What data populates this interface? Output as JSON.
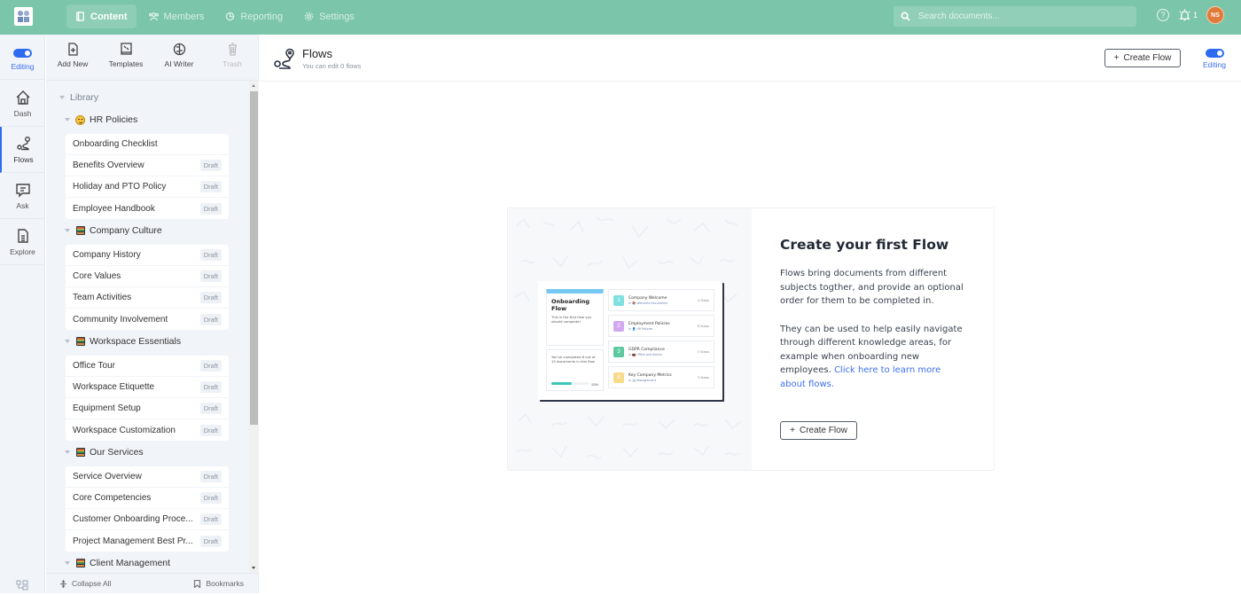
{
  "topbar": {
    "nav": [
      {
        "label": "Content",
        "icon": "book-icon",
        "active": true
      },
      {
        "label": "Members",
        "icon": "users-icon",
        "active": false
      },
      {
        "label": "Reporting",
        "icon": "chart-pie-icon",
        "active": false
      },
      {
        "label": "Settings",
        "icon": "gear-icon",
        "active": false
      }
    ],
    "search_placeholder": "Search documents...",
    "notifications_count": "1",
    "avatar_initials": "NS",
    "brand_color": "#7bc5aa"
  },
  "rail": {
    "toggle_label": "Editing",
    "items": [
      {
        "label": "Dash",
        "icon": "home-icon"
      },
      {
        "label": "Flows",
        "icon": "route-icon",
        "active": true
      },
      {
        "label": "Ask",
        "icon": "chat-icon"
      },
      {
        "label": "Explore",
        "icon": "document-icon"
      }
    ]
  },
  "sidebar": {
    "tools": [
      {
        "label": "Add New",
        "icon": "file-plus-icon"
      },
      {
        "label": "Templates",
        "icon": "template-icon"
      },
      {
        "label": "AI Writer",
        "icon": "brain-icon"
      },
      {
        "label": "Trash",
        "icon": "trash-icon",
        "disabled": true
      }
    ],
    "library_label": "Library",
    "groups": [
      {
        "name": "HR Policies",
        "icon": "smiley-icon",
        "docs": [
          {
            "title": "Onboarding Checklist",
            "badge": ""
          },
          {
            "title": "Benefits Overview",
            "badge": "Draft"
          },
          {
            "title": "Holiday and PTO Policy",
            "badge": "Draft"
          },
          {
            "title": "Employee Handbook",
            "badge": "Draft"
          }
        ]
      },
      {
        "name": "Company Culture",
        "icon": "books-icon",
        "docs": [
          {
            "title": "Company History",
            "badge": "Draft"
          },
          {
            "title": "Core Values",
            "badge": "Draft"
          },
          {
            "title": "Team Activities",
            "badge": "Draft"
          },
          {
            "title": "Community Involvement",
            "badge": "Draft"
          }
        ]
      },
      {
        "name": "Workspace Essentials",
        "icon": "books-icon",
        "docs": [
          {
            "title": "Office Tour",
            "badge": "Draft"
          },
          {
            "title": "Workspace Etiquette",
            "badge": "Draft"
          },
          {
            "title": "Equipment Setup",
            "badge": "Draft"
          },
          {
            "title": "Workspace Customization",
            "badge": "Draft"
          }
        ]
      },
      {
        "name": "Our Services",
        "icon": "books-icon",
        "docs": [
          {
            "title": "Service Overview",
            "badge": "Draft"
          },
          {
            "title": "Core Competencies",
            "badge": "Draft"
          },
          {
            "title": "Customer Onboarding Proce...",
            "badge": "Draft"
          },
          {
            "title": "Project Management Best Pr...",
            "badge": "Draft"
          }
        ]
      },
      {
        "name": "Client Management",
        "icon": "books-icon",
        "docs": []
      }
    ],
    "footer": {
      "collapse_label": "Collapse All",
      "bookmarks_label": "Bookmarks"
    }
  },
  "main": {
    "title": "Flows",
    "subtitle": "You can edit 0 flows",
    "create_button": "Create Flow",
    "toggle_label": "Editing",
    "empty_state": {
      "heading": "Create your first Flow",
      "para1": "Flows bring documents from different subjects togther, and provide an optional order for them to be completed in.",
      "para2_text": "They can be used to help easily navigate through different knowledge areas, for example when onboarding new employees. ",
      "para2_link": "Click here to learn more about flows.",
      "button": "Create Flow",
      "illustration": {
        "title": "Onboarding Flow",
        "desc": "This is the first flow you should complete!",
        "progress_text": "You've completed 8 out of 15 documents in this flow",
        "progress_value": 0.53,
        "progress_label": "53%",
        "steps": [
          {
            "num": "1",
            "title": "Company Welcome",
            "sub": "In 📚 Welcome Documents",
            "count": "4 Steps",
            "color": "#7fe0e0"
          },
          {
            "num": "2",
            "title": "Employment Policies",
            "sub": "In 👤 HR Policies",
            "count": "8 Steps",
            "color": "#d2a9f0"
          },
          {
            "num": "3",
            "title": "GDPR Compliance",
            "sub": "In 💼 Office and Admin",
            "count": "3 Steps",
            "color": "#5cc9a0"
          },
          {
            "num": "4",
            "title": "Key Company Metrics",
            "sub": "In 📊 Management",
            "count": "3 Steps",
            "color": "#f8dc8c"
          }
        ]
      }
    }
  }
}
